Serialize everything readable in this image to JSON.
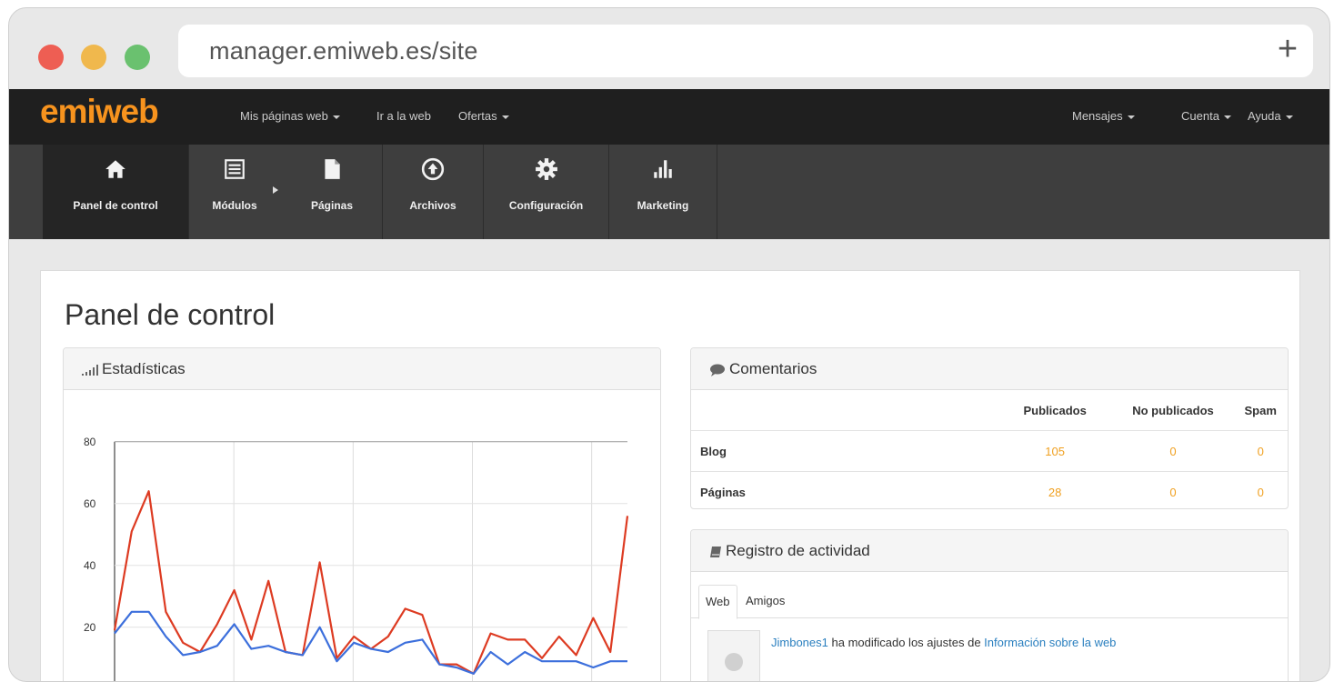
{
  "browser": {
    "url": "manager.emiweb.es/site",
    "new_tab_label": "+"
  },
  "topnav": {
    "logo_part1": "emi",
    "logo_part2": "web",
    "left_items": [
      {
        "label": "Mis páginas web",
        "dropdown": true
      },
      {
        "label": "Ir a la web",
        "dropdown": false
      },
      {
        "label": "Ofertas",
        "dropdown": true
      }
    ],
    "right_items": [
      {
        "label": "Mensajes",
        "dropdown": true
      },
      {
        "label": "Cuenta",
        "dropdown": true
      },
      {
        "label": "Ayuda",
        "dropdown": true
      }
    ]
  },
  "tabs": [
    {
      "label": "Panel de control",
      "icon": "home-icon",
      "active": true
    },
    {
      "label": "Módulos",
      "icon": "list-icon"
    },
    {
      "label": "Páginas",
      "icon": "file-icon"
    },
    {
      "label": "Archivos",
      "icon": "upload-icon"
    },
    {
      "label": "Configuración",
      "icon": "gear-icon"
    },
    {
      "label": "Marketing",
      "icon": "bar-chart-icon"
    }
  ],
  "page": {
    "title": "Panel de control"
  },
  "stats_panel": {
    "title": "Estadísticas",
    "icon": "signal-icon"
  },
  "comments_panel": {
    "title": "Comentarios",
    "icon": "comment-icon",
    "columns": [
      "Publicados",
      "No publicados",
      "Spam"
    ],
    "rows": [
      {
        "label": "Blog",
        "values": [
          "105",
          "0",
          "0"
        ]
      },
      {
        "label": "Páginas",
        "values": [
          "28",
          "0",
          "0"
        ]
      }
    ]
  },
  "activity_panel": {
    "title": "Registro de actividad",
    "icon": "book-icon",
    "tabs": [
      "Web",
      "Amigos"
    ],
    "entries": [
      {
        "user": "Jimbones1",
        "action": "ha modificado los ajustes de",
        "target": "Información sobre la web"
      }
    ]
  },
  "accent_color": "#f7931e",
  "chart_data": {
    "type": "line",
    "y_ticks": [
      20,
      40,
      60,
      80
    ],
    "ylim": [
      0,
      82
    ],
    "x": [
      0,
      1,
      2,
      3,
      4,
      5,
      6,
      7,
      8,
      9,
      10,
      11,
      12,
      13,
      14,
      15,
      16,
      17,
      18,
      19,
      20,
      21,
      22,
      23,
      24,
      25,
      26,
      27,
      28
    ],
    "grid": true,
    "series": [
      {
        "color": "#dd3b22",
        "values": [
          19,
          51,
          64,
          25,
          15,
          12,
          21,
          32,
          16,
          35,
          12,
          11,
          41,
          10,
          17,
          13,
          17,
          26,
          24,
          8,
          8,
          5,
          18,
          16,
          16,
          10,
          17,
          11,
          23,
          12,
          56
        ]
      },
      {
        "color": "#3c6fdc",
        "values": [
          18,
          25,
          25,
          17,
          11,
          12,
          14,
          21,
          13,
          14,
          12,
          11,
          20,
          9,
          15,
          13,
          12,
          15,
          16,
          8,
          7,
          5,
          12,
          8,
          12,
          9,
          9,
          9,
          7,
          9,
          9
        ]
      }
    ]
  }
}
